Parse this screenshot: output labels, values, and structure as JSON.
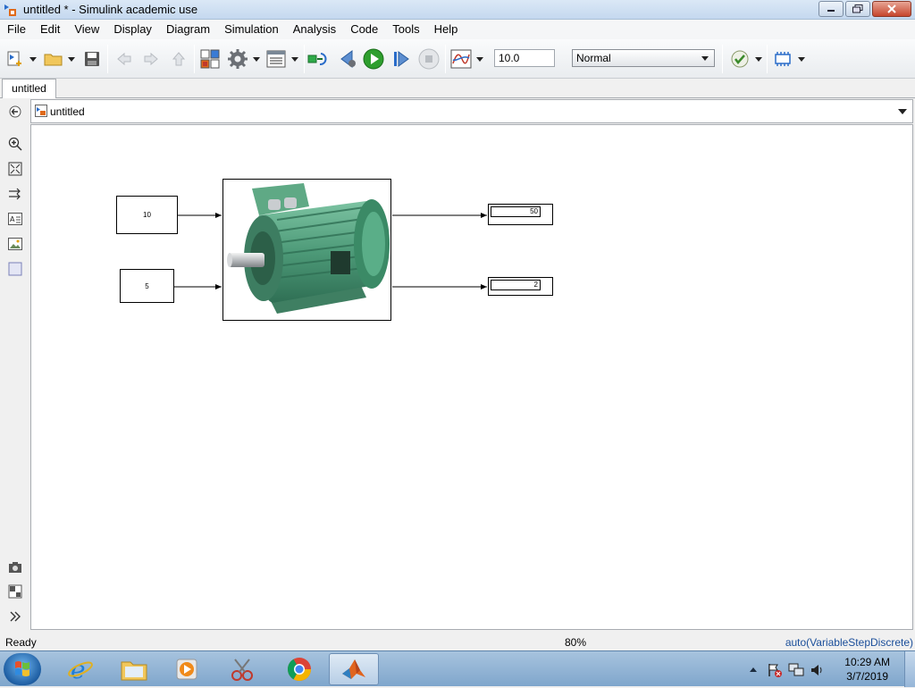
{
  "window": {
    "title": "untitled * - Simulink academic use"
  },
  "menu": [
    "File",
    "Edit",
    "View",
    "Display",
    "Diagram",
    "Simulation",
    "Analysis",
    "Code",
    "Tools",
    "Help"
  ],
  "toolbar": {
    "stop_time": "10.0",
    "sim_mode": "Normal"
  },
  "tabs": [
    {
      "label": "untitled"
    }
  ],
  "breadcrumb": {
    "label": "untitled"
  },
  "diagram": {
    "constant_1": "10",
    "constant_2": "5",
    "display_1": "50",
    "display_2": "2"
  },
  "status": {
    "state": "Ready",
    "zoom": "80%",
    "solver": "auto(VariableStepDiscrete)"
  },
  "taskbar": {
    "time": "10:29 AM",
    "date": "3/7/2019"
  },
  "colors": {
    "run_button": "#2e9e2e",
    "motor_body": "#4d9a78",
    "solver_text": "#1a4e9a"
  }
}
